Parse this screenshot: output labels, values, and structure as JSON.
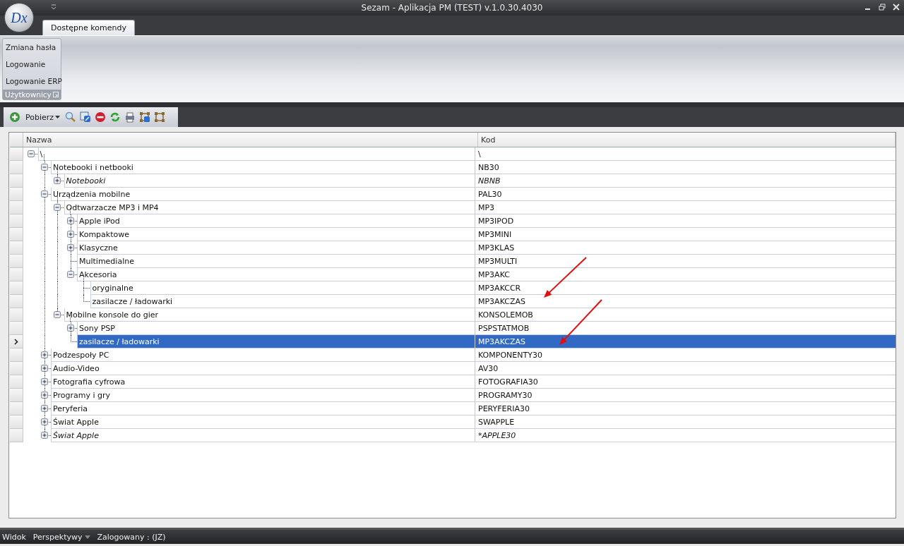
{
  "window": {
    "logo": "Dx",
    "title": "Sezam - Aplikacja PM (TEST) v.1.0.30.4030"
  },
  "ribbon": {
    "tabs": [
      {
        "label": "Dostępne komendy",
        "selected": true
      }
    ],
    "groups": [
      {
        "title": "Użytkownicy",
        "items": [
          "Zmiana hasła",
          "Logowanie",
          "Logowanie ERP"
        ]
      }
    ]
  },
  "toolbar": {
    "dropdown": "Pobierz"
  },
  "tree": {
    "columns": [
      "Nazwa",
      "Kod"
    ],
    "rows": [
      {
        "name": "\\",
        "code": "\\",
        "italic": false,
        "selected": false,
        "expanded": true,
        "children": [
          {
            "name": "Notebooki i netbooki",
            "code": "NB30",
            "italic": false,
            "selected": false,
            "expanded": true,
            "children": [
              {
                "name": "Notebooki",
                "code": "NBNB",
                "italic": true,
                "selected": false,
                "expanded": false
              }
            ]
          },
          {
            "name": "Urządzenia mobilne",
            "code": "PAL30",
            "italic": false,
            "selected": false,
            "expanded": true,
            "children": [
              {
                "name": "Odtwarzacze MP3 i MP4",
                "code": "MP3",
                "italic": false,
                "selected": false,
                "expanded": true,
                "children": [
                  {
                    "name": "Apple iPod",
                    "code": "MP3IPOD",
                    "italic": false,
                    "selected": false,
                    "expanded": false
                  },
                  {
                    "name": "Kompaktowe",
                    "code": "MP3MINI",
                    "italic": false,
                    "selected": false,
                    "expanded": false
                  },
                  {
                    "name": "Klasyczne",
                    "code": "MP3KLAS",
                    "italic": false,
                    "selected": false,
                    "expanded": false
                  },
                  {
                    "name": "Multimedialne",
                    "code": "MP3MULTI",
                    "italic": false,
                    "selected": false
                  },
                  {
                    "name": "Akcesoria",
                    "code": "MP3AKC",
                    "italic": false,
                    "selected": false,
                    "expanded": true,
                    "children": [
                      {
                        "name": "oryginalne",
                        "code": "MP3AKCCR",
                        "italic": false,
                        "selected": false
                      },
                      {
                        "name": "zasilacze / ładowarki",
                        "code": "MP3AKCZAS",
                        "italic": false,
                        "selected": false
                      }
                    ]
                  }
                ]
              },
              {
                "name": "Mobilne konsole do gier",
                "code": "KONSOLEMOB",
                "italic": false,
                "selected": false,
                "expanded": true,
                "children": [
                  {
                    "name": "Sony PSP",
                    "code": "PSPSTATMOB",
                    "italic": false,
                    "selected": false,
                    "expanded": false
                  },
                  {
                    "name": "zasilacze / ładowarki",
                    "code": "MP3AKCZAS",
                    "italic": false,
                    "selected": true
                  }
                ]
              }
            ]
          },
          {
            "name": "Podzespoły PC",
            "code": "KOMPONENTY30",
            "italic": false,
            "selected": false,
            "expanded": false
          },
          {
            "name": "Audio-Video",
            "code": "AV30",
            "italic": false,
            "selected": false,
            "expanded": false
          },
          {
            "name": "Fotografia cyfrowa",
            "code": "FOTOGRAFIA30",
            "italic": false,
            "selected": false,
            "expanded": false
          },
          {
            "name": "Programy i gry",
            "code": "PROGRAMY30",
            "italic": false,
            "selected": false,
            "expanded": false
          },
          {
            "name": "Peryferia",
            "code": "PERYFERIA30",
            "italic": false,
            "selected": false,
            "expanded": false
          },
          {
            "name": "Świat Apple",
            "code": "SWAPPLE",
            "italic": false,
            "selected": false,
            "expanded": false
          },
          {
            "name": "Świat Apple",
            "code": "*APPLE30",
            "italic": true,
            "selected": false,
            "expanded": false
          }
        ]
      }
    ]
  },
  "status_bar": {
    "label": "Widok",
    "menu": "Perspektywy",
    "user": "Zalogowany : (JZ)"
  }
}
